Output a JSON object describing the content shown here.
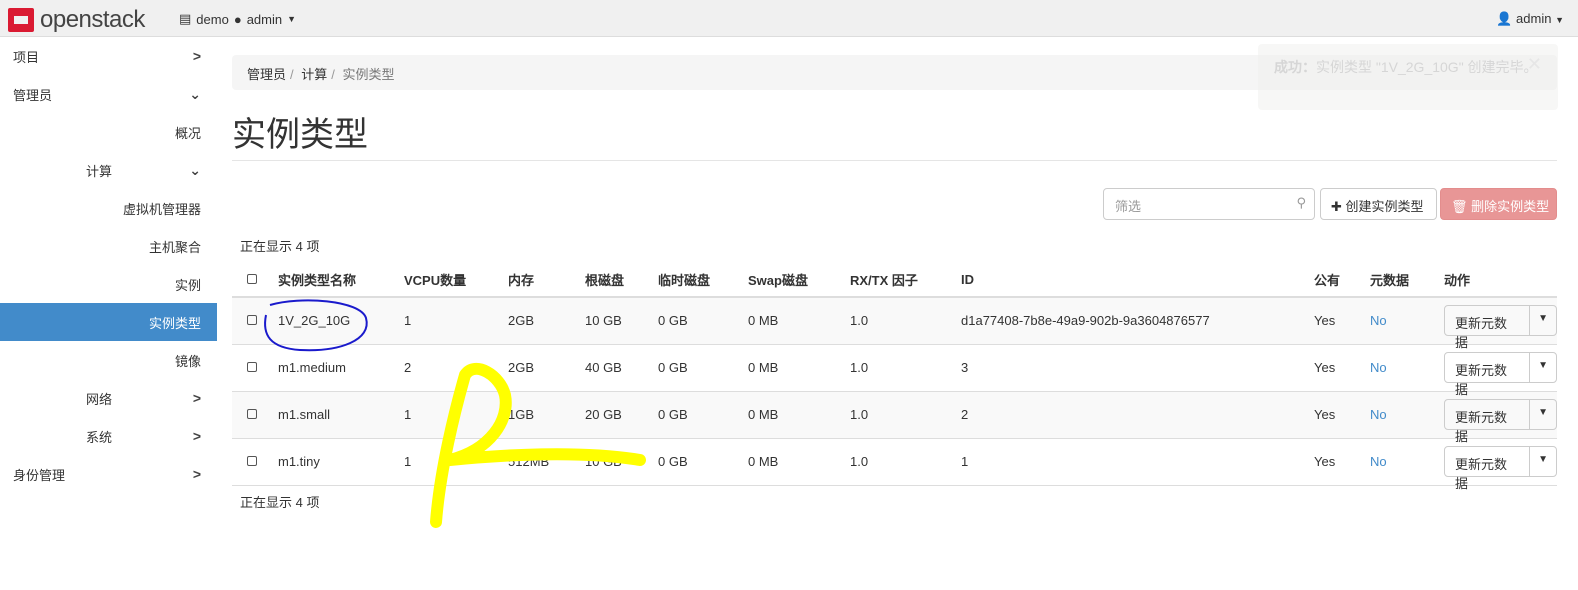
{
  "header": {
    "brand": "openstack",
    "project": "demo",
    "user_in_project": "admin",
    "user": "admin"
  },
  "sidebar": {
    "items": [
      {
        "label": "项目",
        "level": 1
      },
      {
        "label": "管理员",
        "level": 1
      },
      {
        "label": "概况",
        "level": 3
      },
      {
        "label": "计算",
        "level": 2
      },
      {
        "label": "虚拟机管理器",
        "level": 3
      },
      {
        "label": "主机聚合",
        "level": 3
      },
      {
        "label": "实例",
        "level": 3
      },
      {
        "label": "实例类型",
        "level": 3,
        "active": true
      },
      {
        "label": "镜像",
        "level": 3
      },
      {
        "label": "网络",
        "level": 2
      },
      {
        "label": "系统",
        "level": 2
      },
      {
        "label": "身份管理",
        "level": 1
      }
    ]
  },
  "breadcrumb": [
    "管理员",
    "计算",
    "实例类型"
  ],
  "page_title": "实例类型",
  "filter": {
    "placeholder": "筛选"
  },
  "buttons": {
    "create": "创建实例类型",
    "delete": "删除实例类型"
  },
  "count_text": "正在显示 4 项",
  "table": {
    "headers": [
      "实例类型名称",
      "VCPU数量",
      "内存",
      "根磁盘",
      "临时磁盘",
      "Swap磁盘",
      "RX/TX 因子",
      "ID",
      "公有",
      "元数据",
      "动作"
    ],
    "rows": [
      [
        "1V_2G_10G",
        "1",
        "2GB",
        "10 GB",
        "0 GB",
        "0 MB",
        "1.0",
        "d1a77408-7b8e-49a9-902b-9a3604876577",
        "Yes",
        "No"
      ],
      [
        "m1.medium",
        "2",
        "2GB",
        "40 GB",
        "0 GB",
        "0 MB",
        "1.0",
        "3",
        "Yes",
        "No"
      ],
      [
        "m1.small",
        "1",
        "1GB",
        "20 GB",
        "0 GB",
        "0 MB",
        "1.0",
        "2",
        "Yes",
        "No"
      ],
      [
        "m1.tiny",
        "1",
        "512MB",
        "10 GB",
        "0 GB",
        "0 MB",
        "1.0",
        "1",
        "Yes",
        "No"
      ]
    ],
    "action_label": "更新元数据"
  },
  "toast": {
    "title": "成功：",
    "message": "实例类型 \"1V_2G_10G\" 创建完毕。"
  }
}
